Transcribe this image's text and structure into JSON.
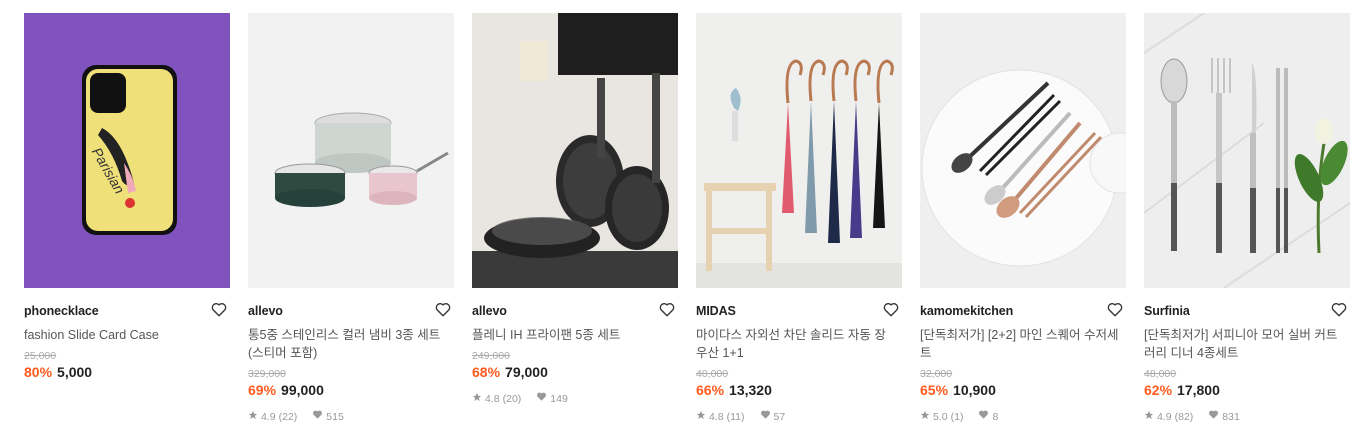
{
  "colors": {
    "discount": "#ff5a1f",
    "price": "#222222",
    "original": "#aaaaaa",
    "meta": "#999999"
  },
  "products": [
    {
      "brand": "phonecklace",
      "title": "fashion Slide Card Case",
      "original_price": "25,000",
      "discount": "80%",
      "price": "5,000",
      "rating": "",
      "reviews": "",
      "likes": ""
    },
    {
      "brand": "allevo",
      "title": "통5중 스테인리스 컬러 냄비 3종 세트 (스티머 포함)",
      "original_price": "329,000",
      "discount": "69%",
      "price": "99,000",
      "rating": "4.9",
      "reviews": "(22)",
      "likes": "515"
    },
    {
      "brand": "allevo",
      "title": "플레니 IH 프라이팬 5종 세트",
      "original_price": "249,000",
      "discount": "68%",
      "price": "79,000",
      "rating": "4.8",
      "reviews": "(20)",
      "likes": "149"
    },
    {
      "brand": "MIDAS",
      "title": "마이다스 자외선 차단 솔리드 자동 장우산 1+1",
      "original_price": "40,000",
      "discount": "66%",
      "price": "13,320",
      "rating": "4.8",
      "reviews": "(11)",
      "likes": "57"
    },
    {
      "brand": "kamomekitchen",
      "title": "[단독최저가] [2+2] 마인 스퀘어 수저세트",
      "original_price": "32,000",
      "discount": "65%",
      "price": "10,900",
      "rating": "5.0",
      "reviews": "(1)",
      "likes": "8"
    },
    {
      "brand": "Surfinia",
      "title": "[단독최저가] 서피니아 모어 실버 커트러리 디너 4종세트",
      "original_price": "48,000",
      "discount": "62%",
      "price": "17,800",
      "rating": "4.9",
      "reviews": "(82)",
      "likes": "831"
    }
  ]
}
